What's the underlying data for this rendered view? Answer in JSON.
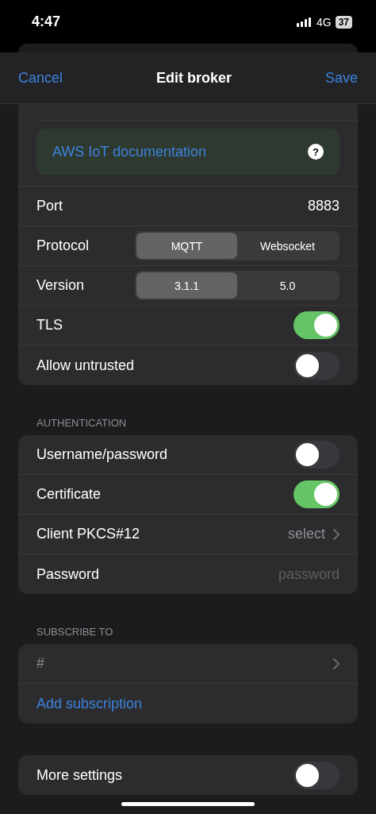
{
  "status_bar": {
    "time": "4:47",
    "network": "4G",
    "battery": "37"
  },
  "nav": {
    "cancel": "Cancel",
    "title": "Edit broker",
    "save": "Save"
  },
  "broker": {
    "doc_link": "AWS IoT documentation",
    "help": "?",
    "rows": [
      {
        "kind": "value",
        "label": "Port",
        "value": "8883"
      },
      {
        "kind": "segmented",
        "label": "Protocol",
        "options": [
          {
            "label": "MQTT",
            "selected": true
          },
          {
            "label": "Websocket",
            "selected": false
          }
        ]
      },
      {
        "kind": "segmented",
        "label": "Version",
        "options": [
          {
            "label": "3.1.1",
            "selected": true
          },
          {
            "label": "5.0",
            "selected": false
          }
        ]
      },
      {
        "kind": "toggle",
        "label": "TLS",
        "on": true
      },
      {
        "kind": "toggle",
        "label": "Allow untrusted",
        "on": false
      }
    ]
  },
  "authentication": {
    "header": "AUTHENTICATION",
    "rows": [
      {
        "kind": "toggle",
        "label": "Username/password",
        "on": false
      },
      {
        "kind": "toggle",
        "label": "Certificate",
        "on": true
      },
      {
        "kind": "picker",
        "label": "Client PKCS#12",
        "value": "select"
      },
      {
        "kind": "field",
        "label": "Password",
        "placeholder": "password"
      }
    ]
  },
  "subscribe": {
    "header": "SUBSCRIBE TO",
    "topics": [
      "#"
    ],
    "add": "Add subscription"
  },
  "more": {
    "label": "More settings",
    "on": false
  }
}
